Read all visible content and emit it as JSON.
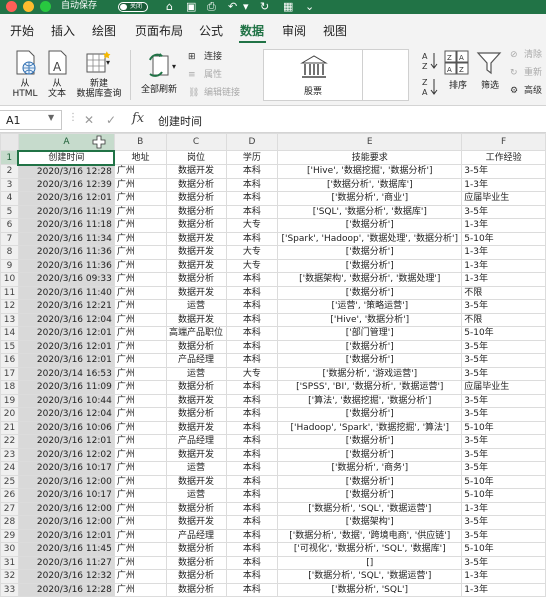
{
  "titlebar": {
    "autosave_label": "自动保存",
    "autosave_state": "关闭"
  },
  "tabs": [
    "开始",
    "插入",
    "绘图",
    "页面布局",
    "公式",
    "数据",
    "审阅",
    "视图"
  ],
  "active_tab": "数据",
  "ribbon": {
    "from_html": "从\nHTML",
    "from_text": "从\n文本",
    "new_query": "新建\n数据库查询",
    "refresh_all": "全部刷新",
    "connections": "连接",
    "properties": "属性",
    "edit_links": "编辑链接",
    "stocks": "股票",
    "sort": "排序",
    "filter": "筛选",
    "clear": "清除",
    "reapply": "重新",
    "advanced": "高级"
  },
  "formula_bar": {
    "name_box": "A1",
    "fx": "fx",
    "value": "创建时间"
  },
  "columns": [
    "A",
    "B",
    "C",
    "D",
    "E",
    "F"
  ],
  "rows": [
    [
      "创建时间",
      "地址",
      "岗位",
      "学历",
      "技能要求",
      "工作经验"
    ],
    [
      "2020/3/16 12:28",
      "广州",
      "数据开发",
      "本科",
      "['Hive', '数据挖掘', '数据分析']",
      "3-5年"
    ],
    [
      "2020/3/16 12:39",
      "广州",
      "数据分析",
      "本科",
      "['数据分析', '数据库']",
      "1-3年"
    ],
    [
      "2020/3/16 12:01",
      "广州",
      "数据分析",
      "本科",
      "['数据分析', '商业']",
      "应届毕业生"
    ],
    [
      "2020/3/16 11:19",
      "广州",
      "数据分析",
      "本科",
      "['SQL', '数据分析', '数据库']",
      "3-5年"
    ],
    [
      "2020/3/16 11:18",
      "广州",
      "数据分析",
      "大专",
      "['数据分析']",
      "1-3年"
    ],
    [
      "2020/3/16 11:34",
      "广州",
      "数据开发",
      "本科",
      "['Spark', 'Hadoop', '数据处理', '数据分析']",
      "5-10年"
    ],
    [
      "2020/3/16 11:36",
      "广州",
      "数据开发",
      "大专",
      "['数据分析']",
      "1-3年"
    ],
    [
      "2020/3/16 11:36",
      "广州",
      "数据开发",
      "大专",
      "['数据分析']",
      "1-3年"
    ],
    [
      "2020/3/16 09:33",
      "广州",
      "数据分析",
      "本科",
      "['数据架构', '数据分析', '数据处理']",
      "1-3年"
    ],
    [
      "2020/3/16 11:40",
      "广州",
      "数据开发",
      "本科",
      "['数据分析']",
      "不限"
    ],
    [
      "2020/3/16 12:21",
      "广州",
      "运营",
      "本科",
      "['运营', '策略运营']",
      "3-5年"
    ],
    [
      "2020/3/16 12:04",
      "广州",
      "数据开发",
      "本科",
      "['Hive', '数据分析']",
      "不限"
    ],
    [
      "2020/3/16 12:01",
      "广州",
      "高端产品职位",
      "本科",
      "['部门管理']",
      "5-10年"
    ],
    [
      "2020/3/16 12:01",
      "广州",
      "数据分析",
      "本科",
      "['数据分析']",
      "3-5年"
    ],
    [
      "2020/3/16 12:01",
      "广州",
      "产品经理",
      "本科",
      "['数据分析']",
      "3-5年"
    ],
    [
      "2020/3/14 16:53",
      "广州",
      "运营",
      "大专",
      "['数据分析', '游戏运营']",
      "3-5年"
    ],
    [
      "2020/3/16 11:09",
      "广州",
      "数据分析",
      "本科",
      "['SPSS', 'BI', '数据分析', '数据运营']",
      "应届毕业生"
    ],
    [
      "2020/3/16 10:44",
      "广州",
      "数据开发",
      "本科",
      "['算法', '数据挖掘', '数据分析']",
      "3-5年"
    ],
    [
      "2020/3/16 12:04",
      "广州",
      "数据分析",
      "本科",
      "['数据分析']",
      "3-5年"
    ],
    [
      "2020/3/16 10:06",
      "广州",
      "数据开发",
      "本科",
      "['Hadoop', 'Spark', '数据挖掘', '算法']",
      "5-10年"
    ],
    [
      "2020/3/16 12:01",
      "广州",
      "产品经理",
      "本科",
      "['数据分析']",
      "3-5年"
    ],
    [
      "2020/3/16 12:02",
      "广州",
      "数据开发",
      "本科",
      "['数据分析']",
      "3-5年"
    ],
    [
      "2020/3/16 10:17",
      "广州",
      "运营",
      "本科",
      "['数据分析', '商务']",
      "3-5年"
    ],
    [
      "2020/3/16 12:00",
      "广州",
      "数据开发",
      "本科",
      "['数据分析']",
      "5-10年"
    ],
    [
      "2020/3/16 10:17",
      "广州",
      "运营",
      "本科",
      "['数据分析']",
      "5-10年"
    ],
    [
      "2020/3/16 12:00",
      "广州",
      "数据分析",
      "本科",
      "['数据分析', 'SQL', '数据运营']",
      "1-3年"
    ],
    [
      "2020/3/16 12:00",
      "广州",
      "数据开发",
      "本科",
      "['数据架构']",
      "3-5年"
    ],
    [
      "2020/3/16 12:01",
      "广州",
      "产品经理",
      "本科",
      "['数据分析', '数据', '跨境电商', '供应链']",
      "3-5年"
    ],
    [
      "2020/3/16 11:45",
      "广州",
      "数据分析",
      "本科",
      "['可视化', '数据分析', 'SQL', '数据库']",
      "5-10年"
    ],
    [
      "2020/3/16 11:27",
      "广州",
      "数据分析",
      "本科",
      "[]",
      "3-5年"
    ],
    [
      "2020/3/16 12:32",
      "广州",
      "数据分析",
      "本科",
      "['数据分析', 'SQL', '数据运营']",
      "1-3年"
    ],
    [
      "2020/3/16 12:28",
      "广州",
      "数据分析",
      "本科",
      "['数据分析', 'SQL']",
      "1-3年"
    ]
  ]
}
